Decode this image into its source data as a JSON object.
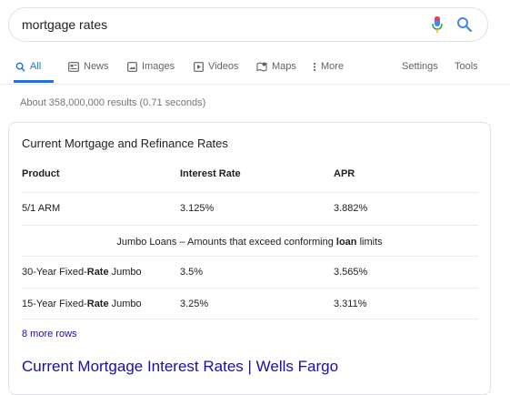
{
  "search": {
    "query": "mortgage rates"
  },
  "tabs": [
    {
      "label": "All",
      "icon": "search-icon",
      "active": true
    },
    {
      "label": "News",
      "icon": "news-icon",
      "active": false
    },
    {
      "label": "Images",
      "icon": "images-icon",
      "active": false
    },
    {
      "label": "Videos",
      "icon": "videos-icon",
      "active": false
    },
    {
      "label": "Maps",
      "icon": "maps-icon",
      "active": false
    },
    {
      "label": "More",
      "icon": "more-vert-icon",
      "active": false
    }
  ],
  "tools": {
    "settings": "Settings",
    "tools": "Tools"
  },
  "result_stats": "About 358,000,000 results (0.71 seconds)",
  "snippet": {
    "title": "Current Mortgage and Refinance Rates",
    "columns": [
      "Product",
      "Interest Rate",
      "APR"
    ],
    "rows": [
      {
        "product_pre": "5/1 ARM",
        "product_bold": "",
        "product_post": "",
        "rate": "3.125%",
        "apr": "3.882%"
      },
      {
        "product_pre": "30-Year Fixed-",
        "product_bold": "Rate",
        "product_post": " Jumbo",
        "rate": "3.5%",
        "apr": "3.565%"
      },
      {
        "product_pre": "15-Year Fixed-",
        "product_bold": "Rate",
        "product_post": " Jumbo",
        "rate": "3.25%",
        "apr": "3.311%"
      }
    ],
    "section_note": {
      "pre": "Jumbo Loans – Amounts that exceed conforming ",
      "bold": "loan",
      "post": " limits"
    },
    "more_rows": "8 more rows"
  },
  "result": {
    "title": "Current Mortgage Interest Rates | Wells Fargo"
  },
  "colors": {
    "accent": "#1a73e8",
    "link": "#1a0dab",
    "mic_red": "#ea4335",
    "mic_blue": "#4285f4"
  }
}
